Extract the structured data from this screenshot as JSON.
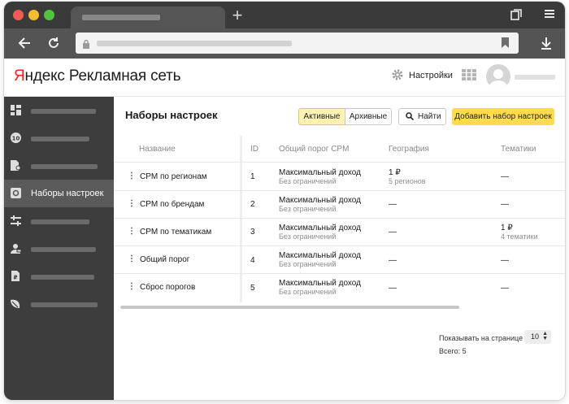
{
  "colors": {
    "accent_yellow": "#ffdb4d",
    "logo_red": "#e5261b",
    "sidebar_bg": "#3d3d3d",
    "sidebar_active": "#5a5a5a",
    "titlebar": "#3a3a3a",
    "navbar": "#545454"
  },
  "app": {
    "logo_first_letter": "Я",
    "logo_rest": "ндекс",
    "logo_product": "Рекламная сеть"
  },
  "header": {
    "settings_label": "Настройки"
  },
  "sidebar": {
    "active_label": "Наборы настроек",
    "icons": [
      "dashboard-icon",
      "number-ten-icon",
      "document-settings-icon",
      "settings-gear-icon",
      "sliders-icon",
      "user-money-icon",
      "document-ruble-icon",
      "leaf-icon"
    ]
  },
  "page": {
    "title": "Наборы настроек",
    "filter_active": "Активные",
    "filter_archive": "Архивные",
    "find_label": "Найти",
    "add_label": "Добавить набор настроек"
  },
  "table": {
    "headers": {
      "name": "Название",
      "id": "ID",
      "cpm": "Общий порог CPM",
      "geo": "География",
      "topics": "Тематики"
    },
    "rows": [
      {
        "name": "CPM по регионам",
        "id": "1",
        "cpm": "Максимальный доход",
        "cpm_sub": "Без ограничений",
        "geo": "1 ₽",
        "geo_sub": "5 регионов",
        "topics": "—",
        "topics_sub": ""
      },
      {
        "name": "CPM по брендам",
        "id": "2",
        "cpm": "Максимальный доход",
        "cpm_sub": "Без ограничений",
        "geo": "—",
        "geo_sub": "",
        "topics": "—",
        "topics_sub": ""
      },
      {
        "name": "CPM по тематикам",
        "id": "3",
        "cpm": "Максимальный доход",
        "cpm_sub": "Без ограничений",
        "geo": "—",
        "geo_sub": "",
        "topics": "1 ₽",
        "topics_sub": "4 тематики"
      },
      {
        "name": "Общий порог",
        "id": "4",
        "cpm": "Максимальный доход",
        "cpm_sub": "Без ограничений",
        "geo": "—",
        "geo_sub": "",
        "topics": "—",
        "topics_sub": ""
      },
      {
        "name": "Сброс порогов",
        "id": "5",
        "cpm": "Максимальный доход",
        "cpm_sub": "Без ограничений",
        "geo": "—",
        "geo_sub": "",
        "topics": "—",
        "topics_sub": ""
      }
    ]
  },
  "pager": {
    "per_page_label": "Показывать на странице",
    "per_page_value": "10",
    "total": "Всего: 5"
  }
}
